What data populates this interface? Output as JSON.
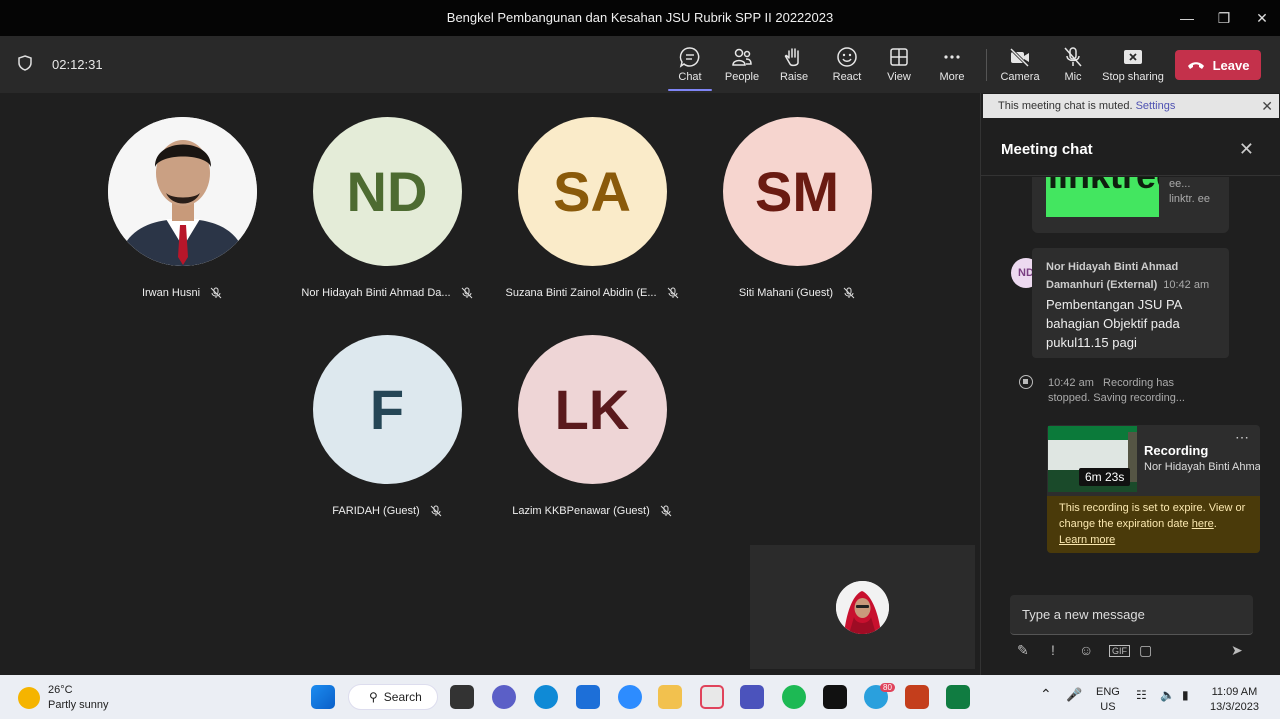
{
  "window": {
    "title": "Bengkel Pembangunan dan Kesahan JSU Rubrik SPP II 20222023",
    "controls": [
      "minimize",
      "maximize",
      "close"
    ]
  },
  "toolbar": {
    "timer": "02:12:31",
    "buttons": [
      {
        "id": "chat",
        "label": "Chat",
        "icon": "chat-icon",
        "active": true
      },
      {
        "id": "people",
        "label": "People",
        "icon": "people-icon"
      },
      {
        "id": "raise",
        "label": "Raise",
        "icon": "hand-icon"
      },
      {
        "id": "react",
        "label": "React",
        "icon": "smile-icon"
      },
      {
        "id": "view",
        "label": "View",
        "icon": "grid-icon"
      },
      {
        "id": "more",
        "label": "More",
        "icon": "more-icon"
      },
      {
        "id": "camera",
        "label": "Camera",
        "icon": "camera-off-icon"
      },
      {
        "id": "mic",
        "label": "Mic",
        "icon": "mic-off-icon"
      },
      {
        "id": "share",
        "label": "Stop sharing",
        "icon": "stop-share-icon"
      }
    ],
    "leave_label": "Leave"
  },
  "participants": [
    {
      "name": "Irwan Husni",
      "initials": "",
      "bg": "#ffffff",
      "fg": "#000000",
      "photo": true
    },
    {
      "name": "Nor Hidayah Binti Ahmad Da...",
      "initials": "ND",
      "bg": "#e4ecd8",
      "fg": "#4d6b31"
    },
    {
      "name": "Suzana Binti Zainol Abidin (E...",
      "initials": "SA",
      "bg": "#faebc9",
      "fg": "#8a5a0a"
    },
    {
      "name": "Siti Mahani (Guest)",
      "initials": "SM",
      "bg": "#f6d5cf",
      "fg": "#6a1b12"
    },
    {
      "name": "FARIDAH (Guest)",
      "initials": "F",
      "bg": "#dde8ee",
      "fg": "#254656"
    },
    {
      "name": "Lazim KKBPenawar (Guest)",
      "initials": "LK",
      "bg": "#eed5d6",
      "fg": "#5a1a1d"
    }
  ],
  "chat": {
    "muted_notice": "This meeting chat is muted.",
    "settings_link": "Settings",
    "header": "Meeting chat",
    "link_preview": {
      "image_text": "linktree",
      "text": "ee... linktr. ee"
    },
    "message": {
      "avatar": "ND",
      "sender": "Nor Hidayah Binti Ahmad Damanhuri (External)",
      "time": "10:42 am",
      "body": "Pembentangan JSU PA bahagian Objektif pada pukul11.15 pagi"
    },
    "system": {
      "time": "10:42 am",
      "text": "Recording has stopped. Saving recording..."
    },
    "recording": {
      "title": "Recording",
      "owner": "Nor Hidayah Binti Ahma...",
      "duration": "6m 23s",
      "warning": "This recording is set to expire. View or change the expiration date",
      "here": "here",
      "learn_more": "Learn more"
    },
    "compose_placeholder": "Type a new message",
    "compose_tools": [
      "format-icon",
      "priority-icon",
      "emoji-icon",
      "gif-icon",
      "sticker-icon",
      "send-icon"
    ]
  },
  "taskbar": {
    "weather_temp": "26°C",
    "weather_desc": "Partly sunny",
    "search_label": "Search",
    "lang_top": "ENG",
    "lang_bottom": "US",
    "clock_time": "11:09 AM",
    "clock_date": "13/3/2023",
    "badge_count": "80"
  },
  "colors": {
    "accent": "#7f85f5",
    "leave": "#c4314b",
    "stage": "#1f1f1f",
    "toolbar": "#292929"
  }
}
